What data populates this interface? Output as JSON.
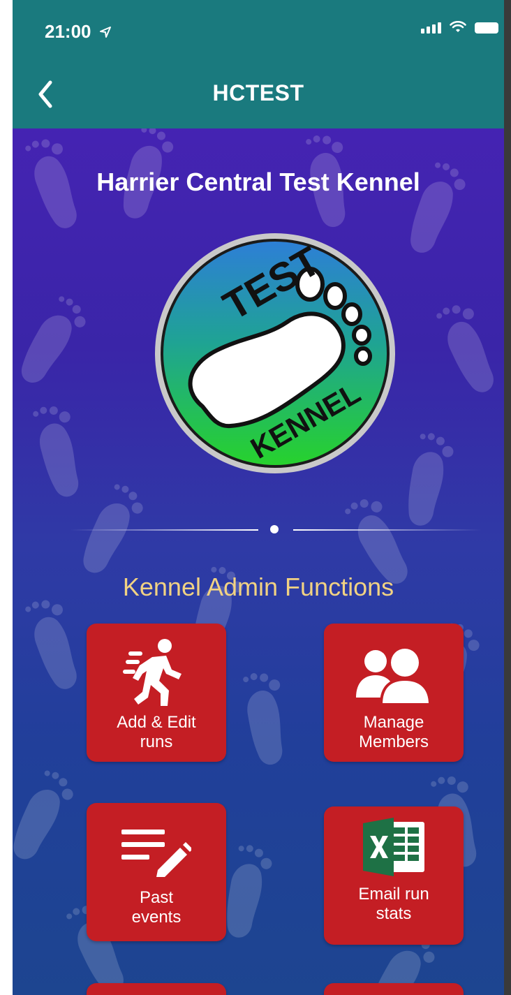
{
  "status": {
    "time": "21:00"
  },
  "nav": {
    "title": "HCTEST"
  },
  "kennel": {
    "name": "Harrier Central Test Kennel",
    "logo_text_top": "TEST",
    "logo_text_bottom": "KENNEL"
  },
  "admin": {
    "section_title": "Kennel Admin Functions",
    "tiles": [
      {
        "line1": "Add & Edit",
        "line2": "runs",
        "icon": "running-person-icon"
      },
      {
        "line1": "Manage",
        "line2": "Members",
        "icon": "members-icon"
      },
      {
        "line1": "Past",
        "line2": "events",
        "icon": "edit-list-icon"
      },
      {
        "line1": "Email run",
        "line2": "stats",
        "icon": "excel-icon"
      }
    ]
  },
  "colors": {
    "header": "#1a7a7e",
    "tile": "#c41e24",
    "section_title": "#f1d283",
    "background": "#3a25a8"
  }
}
